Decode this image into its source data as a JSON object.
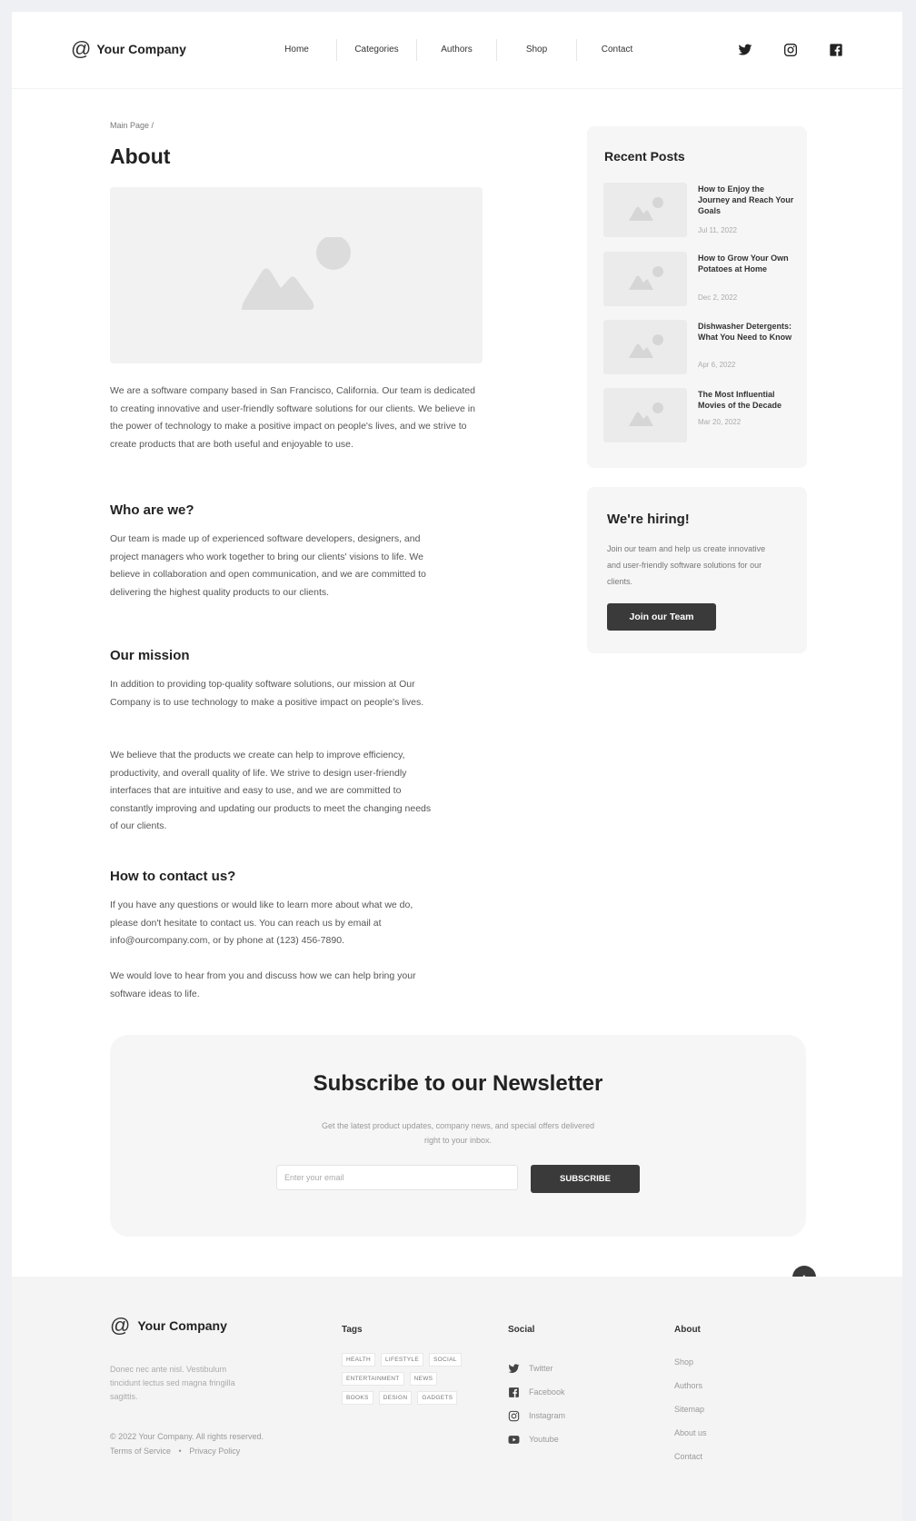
{
  "header": {
    "logo_text": "Your Company",
    "nav": [
      "Home",
      "Categories",
      "Authors",
      "Shop",
      "Contact"
    ],
    "social_icons": [
      "twitter-icon",
      "instagram-icon",
      "facebook-icon"
    ]
  },
  "breadcrumb": "Main Page  /",
  "page_title": "About",
  "intro": "We are a software company based in San Francisco, California. Our team is dedicated to creating innovative and user-friendly software solutions for our clients. We believe in the power of technology to make a positive impact on people's lives, and we strive to create products that are both useful and enjoyable to use.",
  "sections": {
    "who_title": "Who are we?",
    "who_text": "Our team is made up of experienced software developers, designers, and project managers who work together to bring our clients' visions to life. We believe in collaboration and open communication, and we are committed to delivering the highest quality products to our clients.",
    "mission_title": "Our mission",
    "mission_text_1": "In addition to providing top-quality software solutions, our mission at Our Company is to use technology to make a positive impact on people's lives.",
    "mission_text_2": "We believe that the products we create can help to improve efficiency, productivity, and overall quality of life. We strive to design user-friendly interfaces that are intuitive and easy to use, and we are committed to constantly improving and updating our products to meet the changing needs of our clients.",
    "contact_title": "How to contact us?",
    "contact_text_1": "If you have any questions or would like to learn more about what we do, please don't hesitate to contact us. You can reach us by email at info@ourcompany.com, or by phone at (123) 456-7890.",
    "contact_text_2": "We would love to hear from you and discuss how we can help bring your software ideas to life."
  },
  "recent_posts": {
    "title": "Recent Posts",
    "items": [
      {
        "title": "How to Enjoy the Journey and Reach Your Goals",
        "date": "Jul 11, 2022"
      },
      {
        "title": "How to Grow Your Own Potatoes at Home",
        "date": "Dec 2, 2022"
      },
      {
        "title": "Dishwasher Detergents: What You Need to Know",
        "date": "Apr 6, 2022"
      },
      {
        "title": "The Most Influential Movies of the Decade",
        "date": "Mar 20, 2022"
      }
    ]
  },
  "hiring": {
    "title": "We're hiring!",
    "text": "Join our team and help us create innovative and user-friendly software solutions for our clients.",
    "button": "Join our Team"
  },
  "newsletter": {
    "title": "Subscribe to our Newsletter",
    "text": "Get the latest product updates, company news, and special offers delivered right to your inbox.",
    "placeholder": "Enter your email",
    "button": "SUBSCRIBE"
  },
  "back_to_top": "↑",
  "footer": {
    "logo_text": "Your Company",
    "description": "Donec nec ante nisl. Vestibulum tincidunt lectus sed magna fringilla sagittis.",
    "copyright": "© 2022 Your Company.  All rights reserved.",
    "terms": "Terms of Service",
    "separator": "•",
    "privacy": "Privacy Policy",
    "tags_title": "Tags",
    "tags": [
      "HEALTH",
      "LIFESTYLE",
      "SOCIAL",
      "ENTERTAINMENT",
      "NEWS",
      "BOOKS",
      "DESIGN",
      "GADGETS"
    ],
    "social_title": "Social",
    "social": [
      "Twitter",
      "Facebook",
      "Instagram",
      "Youtube"
    ],
    "about_title": "About",
    "about": [
      "Shop",
      "Authors",
      "Sitemap",
      "About us",
      "Contact"
    ]
  }
}
